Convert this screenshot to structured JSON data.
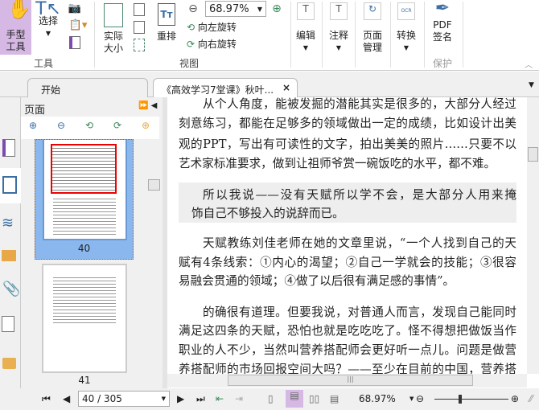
{
  "ribbon": {
    "hand_tool": "手型工具",
    "select": "选择",
    "actual_size": "实际大小",
    "reflow": "重排",
    "zoom_value": "68.97%",
    "rotate_left": "向左旋转",
    "rotate_right": "向右旋转",
    "edit": "编辑",
    "annotate": "注释",
    "page_manage": "页面管理",
    "convert": "转换",
    "pdf_sign": "PDF签名",
    "groups": {
      "tools": "工具",
      "view": "视图",
      "protect": "保护"
    }
  },
  "tabs": [
    {
      "label": "开始"
    },
    {
      "label": "《高效学习7堂课》秋叶..."
    }
  ],
  "pages_panel": {
    "title": "页面",
    "thumbnails": [
      {
        "label": "40"
      },
      {
        "label": "41"
      }
    ]
  },
  "document": {
    "lines": [
      "从个人角度，能被发掘的潜能其实是很多的，大部分人经过",
      "刻意练习，都能在足够多的领域做出一定的成绩，比如设计出美",
      "观的PPT，写出有可读性的文字，拍出美美的照片……只要不以",
      "艺术家标准要求，做到让祖师爷赏一碗饭吃的水平，都不难。",
      "所以我说——没有天赋所以学不会，是大部分人用来掩",
      "饰自己不够投入的说辞而已。",
      "天赋教练刘佳老师在她的文章里说，“一个人找到自己的天",
      "赋有4条线索：①内心的渴望；②自己一学就会的技能；③很容",
      "易融会贯通的领域；④做了以后很有满足感的事情”。",
      "的确很有道理。但要我说，对普通人而言，发现自己能同时",
      "满足这四条的天赋，恐怕也就是吃吃吃了。怪不得想把做饭当作",
      "职业的人不少，当然叫营养搭配师会更好听一点儿。问题是做营",
      "养搭配师的市场回报空间大吗？——至少在目前的中国，营养搭"
    ]
  },
  "status": {
    "page_field": "40 / 305",
    "zoom": "68.97%"
  },
  "colors": {
    "accent": "#d5b8e3",
    "thumb_selected": "#8ab8ee",
    "highlight_bg": "#eeeeee"
  }
}
